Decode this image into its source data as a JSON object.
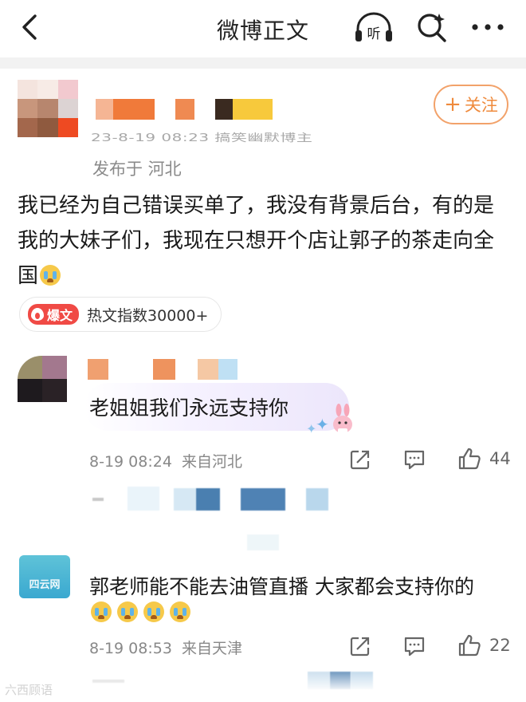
{
  "nav": {
    "title": "微博正文",
    "listen_label": "听"
  },
  "post": {
    "meta_faded": "23-8-19 08:23  搞笑幽默博主",
    "location": "发布于 河北",
    "follow_label": "关注",
    "body_lines": [
      "我已经为自己错误买单了，我没有背景后台，有的是",
      "我的大妹子们，我现在只想开个店让郭子的茶走向全",
      "国"
    ],
    "hot_tag": "爆文",
    "hot_index": "热文指数30000+"
  },
  "comments": [
    {
      "text": "老姐姐我们永远支持你",
      "time": "8-19 08:24",
      "location": "来自河北",
      "likes": "44"
    },
    {
      "text_line1": "郭老师能不能去油管直播  大家都会支持你的",
      "avatar_logo": "四云网",
      "time": "8-19 08:53",
      "location": "来自天津",
      "likes": "22"
    }
  ],
  "watermark": "六西顾语",
  "colors": {
    "accent_orange": "#ef8a3c",
    "hot_red": "#f04a45",
    "meta_gray": "#888888"
  },
  "icons": [
    "back-arrow-icon",
    "listen-headphone-icon",
    "search-sparkle-icon",
    "more-dots-icon",
    "share-icon",
    "comment-icon",
    "like-thumb-icon",
    "cry-emoji-icon"
  ]
}
